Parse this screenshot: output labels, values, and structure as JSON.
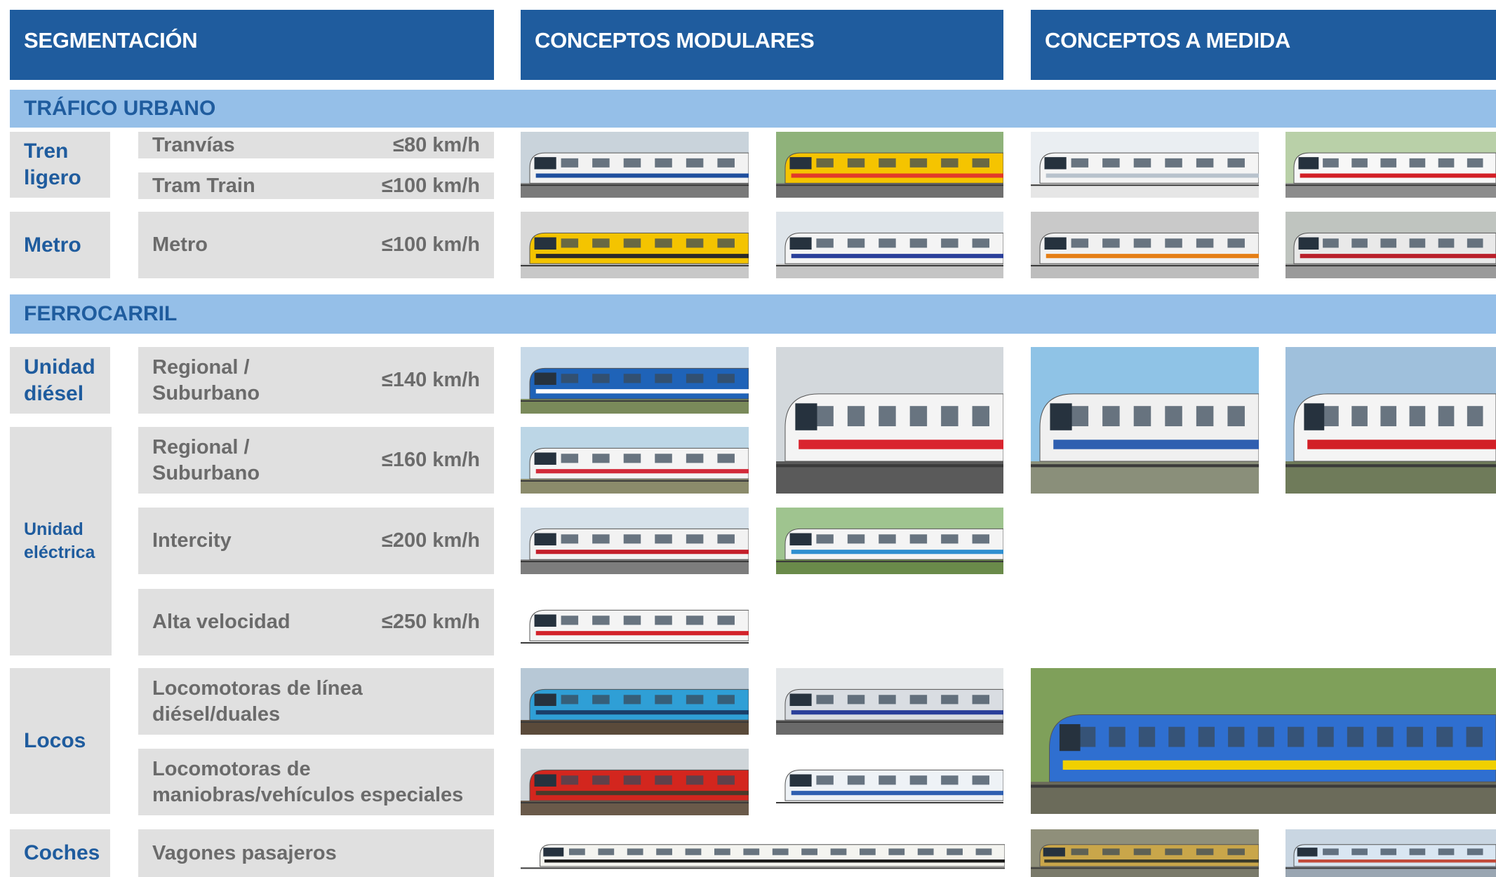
{
  "headers": {
    "segmentation": "SEGMENTACIÓN",
    "modular": "CONCEPTOS MODULARES",
    "custom": "CONCEPTOS A MEDIDA"
  },
  "bands": {
    "urban": "TRÁFICO URBANO",
    "rail": "FERROCARRIL"
  },
  "segments": {
    "light_rail": "Tren\nligero",
    "metro": "Metro",
    "diesel_unit": "Unidad\ndiésel",
    "electric_unit": "Unidad\neléctrica",
    "locos": "Locos",
    "coaches": "Coches"
  },
  "rows": {
    "tram": {
      "name": "Tranvías",
      "speed": "≤80 km/h"
    },
    "tram_train": {
      "name": "Tram Train",
      "speed": "≤100 km/h"
    },
    "metro": {
      "name": "Metro",
      "speed": "≤100 km/h"
    },
    "diesel_regional": {
      "name": "Regional /\nSuburbano",
      "speed": "≤140 km/h"
    },
    "electric_regional": {
      "name": "Regional /\nSuburbano",
      "speed": "≤160 km/h"
    },
    "intercity": {
      "name": "Intercity",
      "speed": "≤200 km/h"
    },
    "high_speed": {
      "name": "Alta velocidad",
      "speed": "≤250 km/h"
    },
    "mainline_locos": {
      "name": "Locomotoras de línea\ndiésel/duales",
      "speed": ""
    },
    "shunting_locos": {
      "name": "Locomotoras de\nmaniobras/vehículos especiales",
      "speed": ""
    },
    "passenger_cars": {
      "name": "Vagones pasajeros",
      "speed": ""
    }
  },
  "colors": {
    "header_blue": "#1f5c9e",
    "band_blue": "#95bfe8",
    "cell_grey": "#e0e0e0",
    "label_grey": "#6b6b6b"
  }
}
